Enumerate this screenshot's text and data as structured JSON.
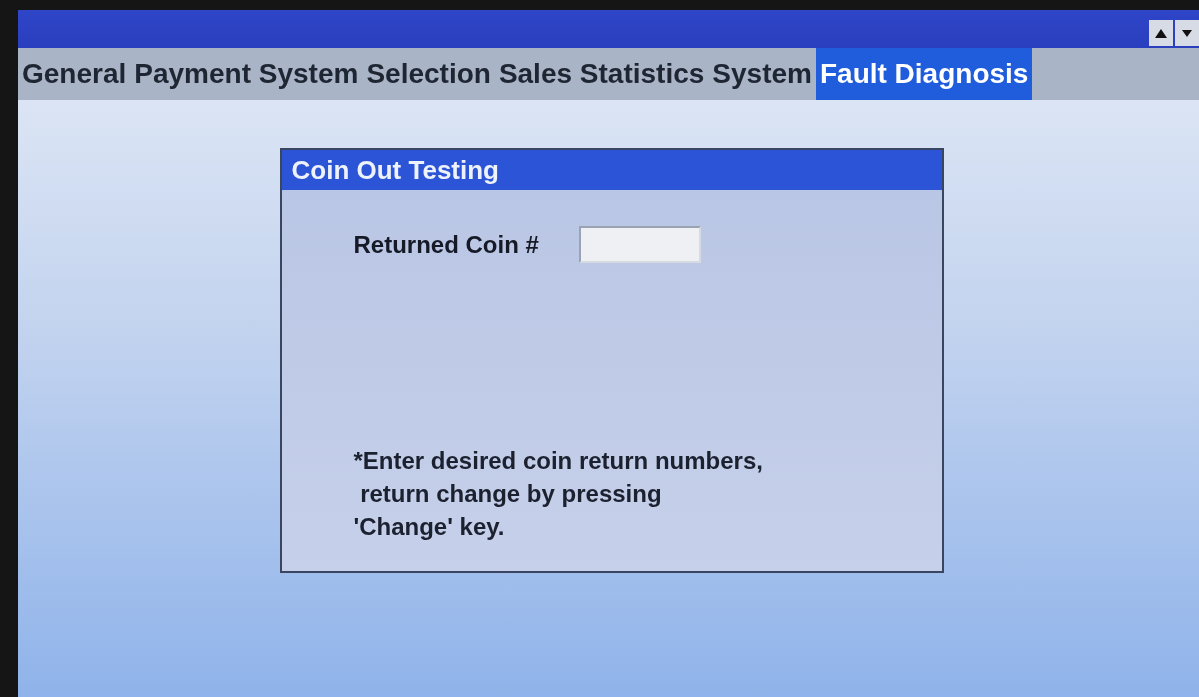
{
  "tabs": [
    {
      "label": "General",
      "selected": false
    },
    {
      "label": "Payment System",
      "selected": false
    },
    {
      "label": "Selection",
      "selected": false
    },
    {
      "label": "Sales Statistics",
      "selected": false
    },
    {
      "label": "System",
      "selected": false
    },
    {
      "label": "Fault Diagnosis",
      "selected": true
    }
  ],
  "dialog": {
    "title": "Coin Out Testing",
    "field": {
      "label": "Returned Coin #"
    },
    "note": "*Enter desired coin return numbers,\n return change by pressing\n'Change' key."
  }
}
